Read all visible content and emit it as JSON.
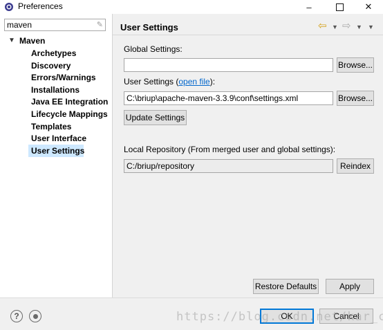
{
  "window": {
    "title": "Preferences"
  },
  "filter": {
    "value": "maven"
  },
  "tree": {
    "root": "Maven",
    "children": [
      "Archetypes",
      "Discovery",
      "Errors/Warnings",
      "Installations",
      "Java EE Integration",
      "Lifecycle Mappings",
      "Templates",
      "User Interface",
      "User Settings"
    ],
    "selected": "User Settings"
  },
  "page": {
    "title": "User Settings",
    "global_label": "Global Settings:",
    "global_value": "",
    "browse": "Browse...",
    "user_label_prefix": "User Settings (",
    "open_file": "open file",
    "user_label_suffix": "):",
    "user_value": "C:\\briup\\apache-maven-3.3.9\\conf\\settings.xml",
    "update": "Update Settings",
    "local_label": "Local Repository (From merged user and global settings):",
    "local_value": "C:/briup/repository",
    "reindex": "Reindex",
    "restore": "Restore Defaults",
    "apply": "Apply"
  },
  "footer": {
    "ok": "OK",
    "cancel": "Cancel"
  },
  "watermark": "https://blog.csdn.net/kar_ch",
  "colors": {
    "selection": "#cde8ff",
    "link": "#0066cc",
    "default_button_border": "#0078d7"
  }
}
